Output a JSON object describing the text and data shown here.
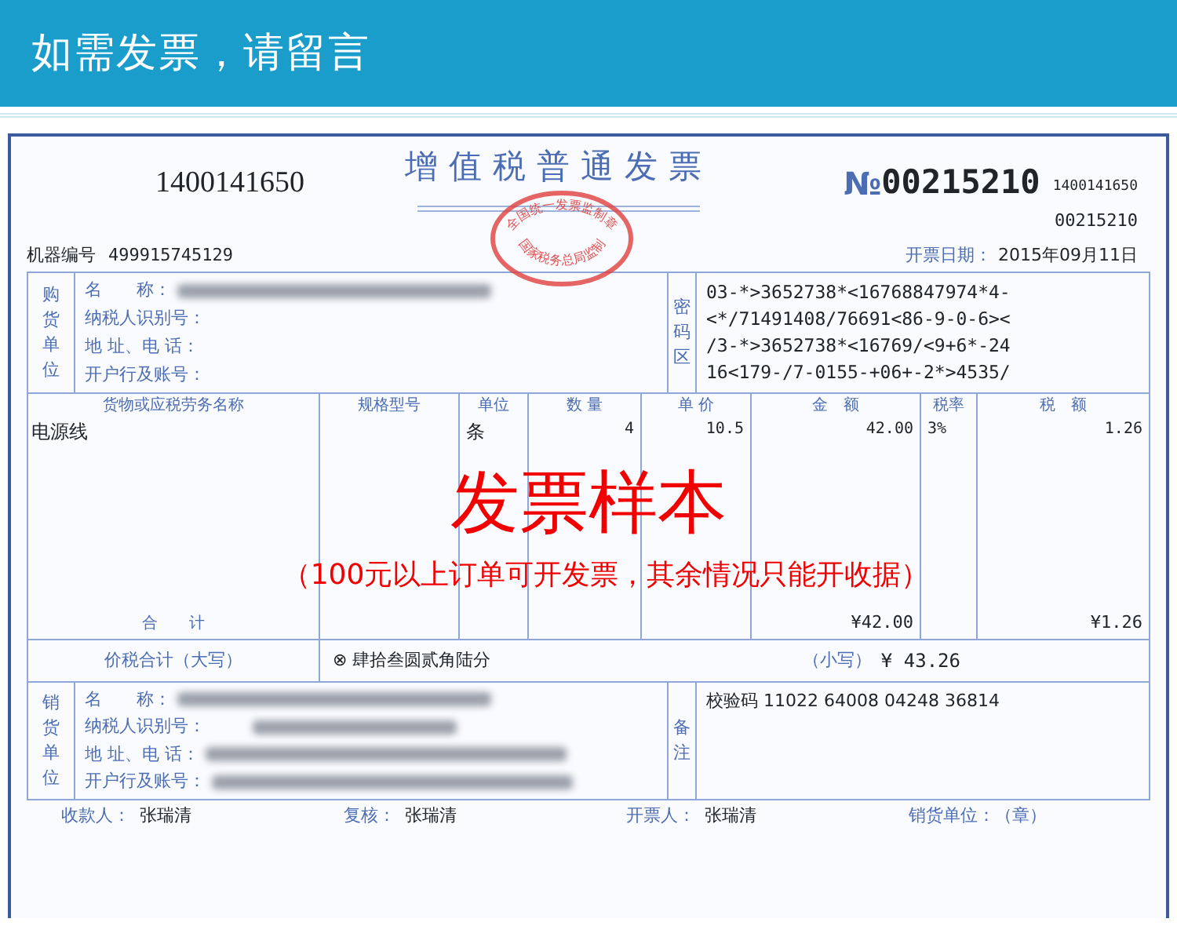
{
  "header": {
    "title": "如需发票，请留言"
  },
  "invoice": {
    "code": "1400141650",
    "title": "增值税普通发票",
    "stamp": {
      "top": "全国统一发票监制章",
      "bottom": "国家税务总局监制"
    },
    "number_symbol": "№",
    "number": "00215210",
    "small_code": "1400141650",
    "small_number": "00215210",
    "machine_label": "机器编号",
    "machine_no": "499915745129",
    "date_label": "开票日期：",
    "date": "2015年09月11日"
  },
  "buyer": {
    "side_label": "购货单位",
    "fields": [
      {
        "label": "名　　称：",
        "redacted": true
      },
      {
        "label": "纳税人识别号：",
        "redacted": false
      },
      {
        "label": "地 址、电 话：",
        "redacted": false
      },
      {
        "label": "开户行及账号：",
        "redacted": false
      }
    ],
    "code_label": "密码区",
    "code_lines": [
      "03-*>3652738*<16768847974*4-",
      "<*/71491408/76691<86-9-0-6><",
      "/3-*>3652738*<16769/<9+6*-24",
      "16<179-/7-0155-+06+-2*>4535/"
    ]
  },
  "items": {
    "columns": [
      "货物或应税劳务名称",
      "规格型号",
      "单位",
      "数 量",
      "单 价",
      "金　额",
      "税率",
      "税　额"
    ],
    "rows": [
      [
        "电源线",
        "",
        "条",
        "4",
        "10.5",
        "42.00",
        "3%",
        "1.26"
      ]
    ],
    "total_label": "合　　计",
    "total_amount": "¥42.00",
    "total_tax": "¥1.26"
  },
  "sample_stamp": {
    "title": "发票样本",
    "note": "（100元以上订单可开发票，其余情况只能开收据）"
  },
  "tax_total": {
    "label": "价税合计（大写）",
    "words": "⊗ 肆拾叁圆贰角陆分",
    "small_label": "（小写）",
    "small_amount": "¥ 43.26"
  },
  "seller": {
    "side_label": "销货单位",
    "fields": [
      {
        "label": "名　　称：",
        "redacted": true
      },
      {
        "label": "纳税人识别号：",
        "redacted": true
      },
      {
        "label": "地 址、电 话：",
        "redacted": true
      },
      {
        "label": "开户行及账号：",
        "redacted": true
      }
    ],
    "remarks_label": "备注",
    "remarks": "校验码 11022 64008 04248 36814"
  },
  "footer": [
    {
      "label": "收款人：",
      "value": "张瑞清"
    },
    {
      "label": "复核：",
      "value": "张瑞清"
    },
    {
      "label": "开票人：",
      "value": "张瑞清"
    },
    {
      "label": "销货单位：（章）"
    }
  ]
}
